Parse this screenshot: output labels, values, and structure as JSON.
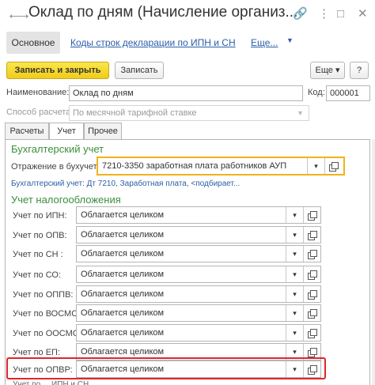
{
  "window": {
    "title": "Оклад по дням (Начисление организ...",
    "icons": [
      "back-arrow-icon",
      "forward-arrow-icon",
      "link-icon",
      "more-vertical-icon",
      "maximize-icon",
      "close-icon"
    ],
    "glyphs": {
      "back": "←",
      "forward": "→",
      "link": "🔗",
      "more": "⋮",
      "maximize": "□",
      "close": "✕"
    }
  },
  "section_tabs": {
    "main": "Основное",
    "links": [
      "Коды строк декларации по ИПН и СН",
      "Еще..."
    ],
    "more_arrow": "▼"
  },
  "toolbar": {
    "save_close": "Записать и закрыть",
    "save": "Записать",
    "more": "Еще",
    "more_arrow": "▾",
    "help": "?"
  },
  "header_fields": {
    "name_label": "Наименование:",
    "name_value": "Оклад по дням",
    "code_label": "Код:",
    "code_value": "000001",
    "calc_method_label": "Способ расчета:",
    "calc_method_value": "По месячной тарифной ставке"
  },
  "inner_tabs": [
    "Расчеты",
    "Учет",
    "Прочее"
  ],
  "accounting": {
    "title": "Бухгалтерский учет",
    "reflection_label": "Отражение в бухучете:",
    "reflection_value": "7210-3350 заработная плата работников АУП",
    "hint": "Бухгалтерский учет: Дт 7210, Заработная плата, <подбирает..."
  },
  "tax": {
    "title": "Учет налогообложения",
    "rows": [
      {
        "label": "Учет по ИПН:",
        "value": "Облагается целиком"
      },
      {
        "label": "Учет по ОПВ:",
        "value": "Облагается целиком"
      },
      {
        "label": "Учет по СН :",
        "value": "Облагается целиком"
      },
      {
        "label": "Учет по СО:",
        "value": "Облагается целиком"
      },
      {
        "label": "Учет по ОППВ:",
        "value": "Облагается целиком"
      },
      {
        "label": "Учет по ВОСМС:",
        "value": "Облагается целиком"
      },
      {
        "label": "Учет по ООСМС:",
        "value": "Облагается целиком"
      },
      {
        "label": "Учет по ЕП:",
        "value": "Облагается целиком"
      },
      {
        "label": "Учет по ОПВР:",
        "value": "Облагается целиком"
      }
    ],
    "cutoff_text": "Учет по ...  ИПН и СН"
  },
  "colors": {
    "accent_yellow": "#f0cc1a",
    "highlight_orange": "#f2b21a",
    "highlight_red": "#e0262b",
    "link_blue": "#2a5ea8",
    "group_green": "#3b8f3b"
  }
}
